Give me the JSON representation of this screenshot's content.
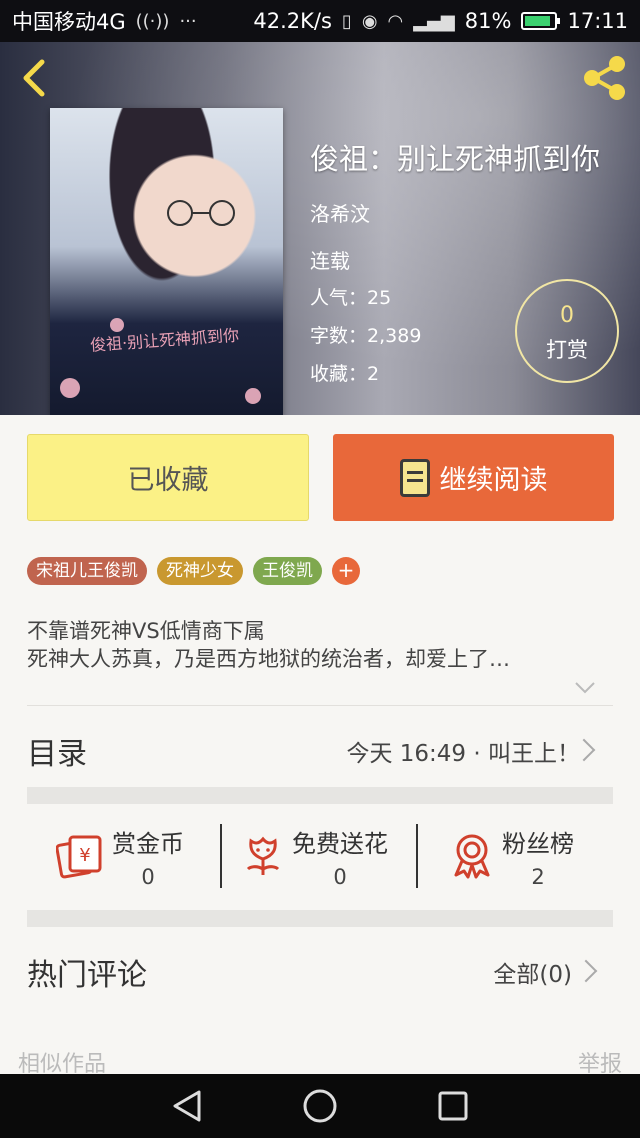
{
  "status_bar": {
    "carrier": "中国移动4G",
    "speed": "42.2K/s",
    "network": "4G",
    "battery": "81%",
    "time": "17:11"
  },
  "book": {
    "title": "俊祖：别让死神抓到你",
    "author": "洛希汶",
    "status": "连载",
    "popularity_label": "人气：",
    "popularity": "25",
    "words_label": "字数：",
    "words": "2,389",
    "favorites_label": "收藏：",
    "favorites": "2",
    "cover_text": "俊祖·别让死神抓到你"
  },
  "tip": {
    "count": "0",
    "label": "打赏"
  },
  "actions": {
    "saved_label": "已收藏",
    "read_label": "继续阅读"
  },
  "tags": [
    {
      "label": "宋祖儿王俊凯",
      "color": "#c0644e"
    },
    {
      "label": "死神少女",
      "color": "#c9982f"
    },
    {
      "label": "王俊凯",
      "color": "#7fa84e"
    }
  ],
  "tag_add": "+",
  "description": {
    "line1": "不靠谱死神VS低情商下属",
    "line2": "死神大人苏真，乃是西方地狱的统治者，却爱上了…"
  },
  "catalog": {
    "title": "目录",
    "latest": "今天 16:49 · 叫王上！"
  },
  "stats": [
    {
      "label": "赏金币",
      "value": "0",
      "icon": "coin-envelope-icon"
    },
    {
      "label": "免费送花",
      "value": "0",
      "icon": "flower-icon"
    },
    {
      "label": "粉丝榜",
      "value": "2",
      "icon": "medal-icon"
    }
  ],
  "comments": {
    "title": "热门评论",
    "all_label": "全部(0)"
  },
  "footer": {
    "similar": "相似作品",
    "report": "举报"
  },
  "colors": {
    "accent": "#e8683a",
    "saved_bg": "#fbf186",
    "icon_red": "#d0402c",
    "tip_yellow": "#f6e48f"
  }
}
